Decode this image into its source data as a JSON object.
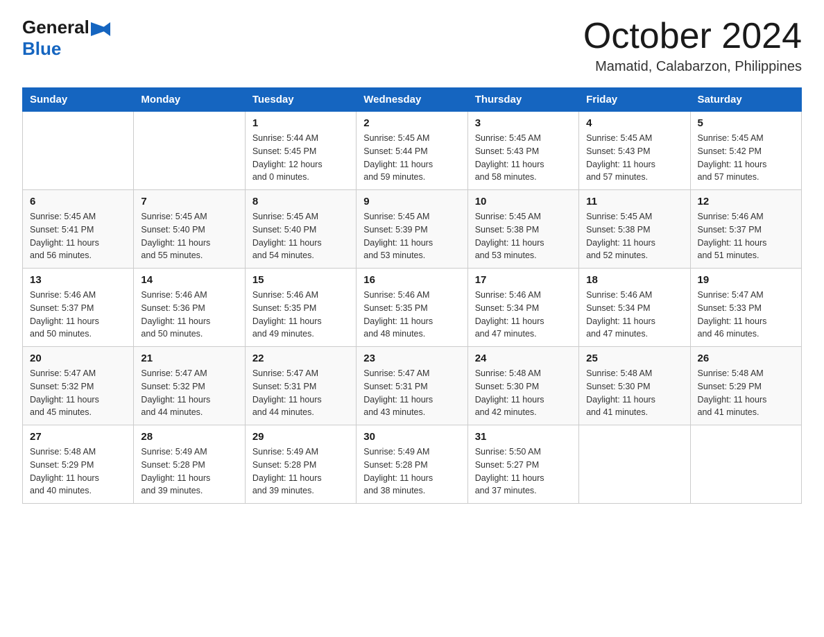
{
  "header": {
    "logo_general": "General",
    "logo_blue": "Blue",
    "month_title": "October 2024",
    "location": "Mamatid, Calabarzon, Philippines"
  },
  "days_of_week": [
    "Sunday",
    "Monday",
    "Tuesday",
    "Wednesday",
    "Thursday",
    "Friday",
    "Saturday"
  ],
  "weeks": [
    [
      {
        "day": "",
        "info": ""
      },
      {
        "day": "",
        "info": ""
      },
      {
        "day": "1",
        "info": "Sunrise: 5:44 AM\nSunset: 5:45 PM\nDaylight: 12 hours\nand 0 minutes."
      },
      {
        "day": "2",
        "info": "Sunrise: 5:45 AM\nSunset: 5:44 PM\nDaylight: 11 hours\nand 59 minutes."
      },
      {
        "day": "3",
        "info": "Sunrise: 5:45 AM\nSunset: 5:43 PM\nDaylight: 11 hours\nand 58 minutes."
      },
      {
        "day": "4",
        "info": "Sunrise: 5:45 AM\nSunset: 5:43 PM\nDaylight: 11 hours\nand 57 minutes."
      },
      {
        "day": "5",
        "info": "Sunrise: 5:45 AM\nSunset: 5:42 PM\nDaylight: 11 hours\nand 57 minutes."
      }
    ],
    [
      {
        "day": "6",
        "info": "Sunrise: 5:45 AM\nSunset: 5:41 PM\nDaylight: 11 hours\nand 56 minutes."
      },
      {
        "day": "7",
        "info": "Sunrise: 5:45 AM\nSunset: 5:40 PM\nDaylight: 11 hours\nand 55 minutes."
      },
      {
        "day": "8",
        "info": "Sunrise: 5:45 AM\nSunset: 5:40 PM\nDaylight: 11 hours\nand 54 minutes."
      },
      {
        "day": "9",
        "info": "Sunrise: 5:45 AM\nSunset: 5:39 PM\nDaylight: 11 hours\nand 53 minutes."
      },
      {
        "day": "10",
        "info": "Sunrise: 5:45 AM\nSunset: 5:38 PM\nDaylight: 11 hours\nand 53 minutes."
      },
      {
        "day": "11",
        "info": "Sunrise: 5:45 AM\nSunset: 5:38 PM\nDaylight: 11 hours\nand 52 minutes."
      },
      {
        "day": "12",
        "info": "Sunrise: 5:46 AM\nSunset: 5:37 PM\nDaylight: 11 hours\nand 51 minutes."
      }
    ],
    [
      {
        "day": "13",
        "info": "Sunrise: 5:46 AM\nSunset: 5:37 PM\nDaylight: 11 hours\nand 50 minutes."
      },
      {
        "day": "14",
        "info": "Sunrise: 5:46 AM\nSunset: 5:36 PM\nDaylight: 11 hours\nand 50 minutes."
      },
      {
        "day": "15",
        "info": "Sunrise: 5:46 AM\nSunset: 5:35 PM\nDaylight: 11 hours\nand 49 minutes."
      },
      {
        "day": "16",
        "info": "Sunrise: 5:46 AM\nSunset: 5:35 PM\nDaylight: 11 hours\nand 48 minutes."
      },
      {
        "day": "17",
        "info": "Sunrise: 5:46 AM\nSunset: 5:34 PM\nDaylight: 11 hours\nand 47 minutes."
      },
      {
        "day": "18",
        "info": "Sunrise: 5:46 AM\nSunset: 5:34 PM\nDaylight: 11 hours\nand 47 minutes."
      },
      {
        "day": "19",
        "info": "Sunrise: 5:47 AM\nSunset: 5:33 PM\nDaylight: 11 hours\nand 46 minutes."
      }
    ],
    [
      {
        "day": "20",
        "info": "Sunrise: 5:47 AM\nSunset: 5:32 PM\nDaylight: 11 hours\nand 45 minutes."
      },
      {
        "day": "21",
        "info": "Sunrise: 5:47 AM\nSunset: 5:32 PM\nDaylight: 11 hours\nand 44 minutes."
      },
      {
        "day": "22",
        "info": "Sunrise: 5:47 AM\nSunset: 5:31 PM\nDaylight: 11 hours\nand 44 minutes."
      },
      {
        "day": "23",
        "info": "Sunrise: 5:47 AM\nSunset: 5:31 PM\nDaylight: 11 hours\nand 43 minutes."
      },
      {
        "day": "24",
        "info": "Sunrise: 5:48 AM\nSunset: 5:30 PM\nDaylight: 11 hours\nand 42 minutes."
      },
      {
        "day": "25",
        "info": "Sunrise: 5:48 AM\nSunset: 5:30 PM\nDaylight: 11 hours\nand 41 minutes."
      },
      {
        "day": "26",
        "info": "Sunrise: 5:48 AM\nSunset: 5:29 PM\nDaylight: 11 hours\nand 41 minutes."
      }
    ],
    [
      {
        "day": "27",
        "info": "Sunrise: 5:48 AM\nSunset: 5:29 PM\nDaylight: 11 hours\nand 40 minutes."
      },
      {
        "day": "28",
        "info": "Sunrise: 5:49 AM\nSunset: 5:28 PM\nDaylight: 11 hours\nand 39 minutes."
      },
      {
        "day": "29",
        "info": "Sunrise: 5:49 AM\nSunset: 5:28 PM\nDaylight: 11 hours\nand 39 minutes."
      },
      {
        "day": "30",
        "info": "Sunrise: 5:49 AM\nSunset: 5:28 PM\nDaylight: 11 hours\nand 38 minutes."
      },
      {
        "day": "31",
        "info": "Sunrise: 5:50 AM\nSunset: 5:27 PM\nDaylight: 11 hours\nand 37 minutes."
      },
      {
        "day": "",
        "info": ""
      },
      {
        "day": "",
        "info": ""
      }
    ]
  ]
}
